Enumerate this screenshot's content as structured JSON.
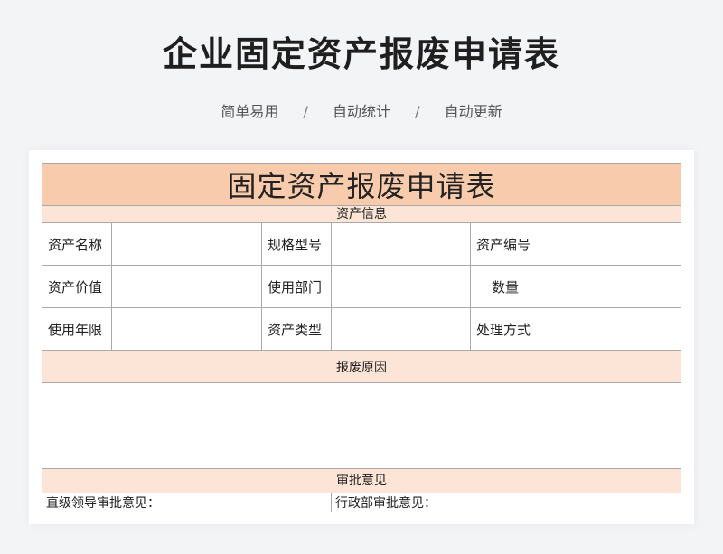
{
  "page": {
    "title": "企业固定资产报废申请表",
    "tags": [
      "简单易用",
      "自动统计",
      "自动更新"
    ],
    "separator": "/"
  },
  "form": {
    "title": "固定资产报废申请表",
    "sections": {
      "info": "资产信息",
      "reason": "报废原因",
      "approval": "审批意见"
    },
    "fields": {
      "asset_name": "资产名称",
      "spec_model": "规格型号",
      "asset_number": "资产编号",
      "asset_value": "资产价值",
      "department": "使用部门",
      "quantity": "数量",
      "service_life": "使用年限",
      "asset_type": "资产类型",
      "disposal_method": "处理方式"
    },
    "approvals": {
      "direct_leader": "直级领导审批意见：",
      "admin_dept": "行政部审批意见："
    }
  }
}
